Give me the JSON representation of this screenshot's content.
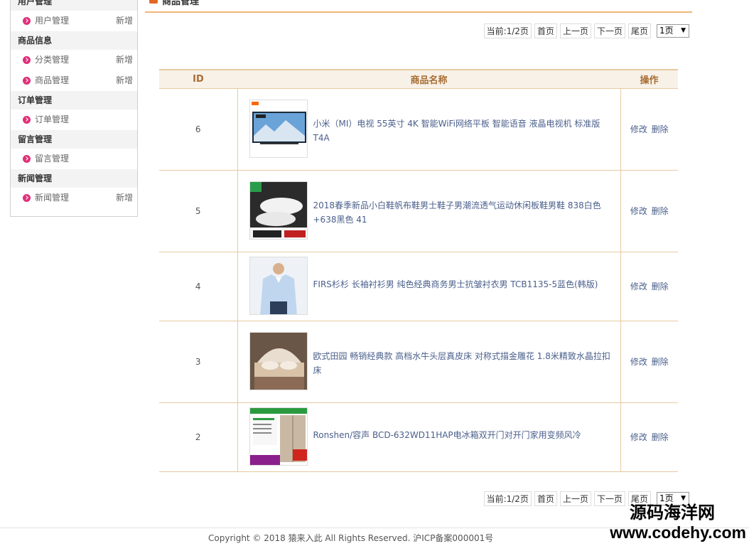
{
  "sidebar": {
    "groups": [
      {
        "title": "用户管理",
        "items": [
          {
            "label": "用户管理",
            "add": "新增"
          }
        ]
      },
      {
        "title": "商品信息",
        "items": [
          {
            "label": "分类管理",
            "add": "新增"
          },
          {
            "label": "商品管理",
            "add": "新增"
          }
        ]
      },
      {
        "title": "订单管理",
        "items": [
          {
            "label": "订单管理",
            "add": ""
          }
        ]
      },
      {
        "title": "留言管理",
        "items": [
          {
            "label": "留言管理",
            "add": ""
          }
        ]
      },
      {
        "title": "新闻管理",
        "items": [
          {
            "label": "新闻管理",
            "add": "新增"
          }
        ]
      }
    ]
  },
  "main": {
    "title": "商品管理",
    "pager": {
      "current": "当前:1/2页",
      "first": "首页",
      "prev": "上一页",
      "next": "下一页",
      "last": "尾页",
      "select_value": "1页"
    },
    "table": {
      "headers": {
        "id": "ID",
        "name": "商品名称",
        "op": "操作"
      },
      "rows": [
        {
          "id": "6",
          "name": "小米（MI）电视 55英寸 4K 智能WiFi网络平板 智能语音 液晶电视机 标准版T4A",
          "edit": "修改",
          "del": "删除",
          "thumb": "tv"
        },
        {
          "id": "5",
          "name": "2018春季新品小白鞋帆布鞋男士鞋子男潮流透气运动休闲板鞋男鞋 838白色+638黑色 41",
          "edit": "修改",
          "del": "删除",
          "thumb": "shoes"
        },
        {
          "id": "4",
          "name": "FIRS杉杉 长袖衬衫男 纯色经典商务男士抗皱衬衣男 TCB1135-5蓝色(韩版)",
          "edit": "修改",
          "del": "删除",
          "thumb": "shirt"
        },
        {
          "id": "3",
          "name": "欧式田园 畅销经典款 高档水牛头层真皮床 对称式描金雕花 1.8米精致水晶拉扣床",
          "edit": "修改",
          "del": "删除",
          "thumb": "bed"
        },
        {
          "id": "2",
          "name": "Ronshen/容声 BCD-632WD11HAP电冰箱双开门对开门家用变频风冷",
          "edit": "修改",
          "del": "删除",
          "thumb": "fridge"
        }
      ]
    }
  },
  "footer": {
    "copyright": "Copyright © 2018 猿来入此 All Rights Reserved. 沪ICP备案000001号"
  },
  "watermark": {
    "cn": "源码海洋网",
    "en": "www.codehy.com"
  },
  "colors": {
    "accent": "#f0b67b",
    "link": "#4a5f8b",
    "header_text": "#a86c33",
    "dot": "#e0307a"
  }
}
